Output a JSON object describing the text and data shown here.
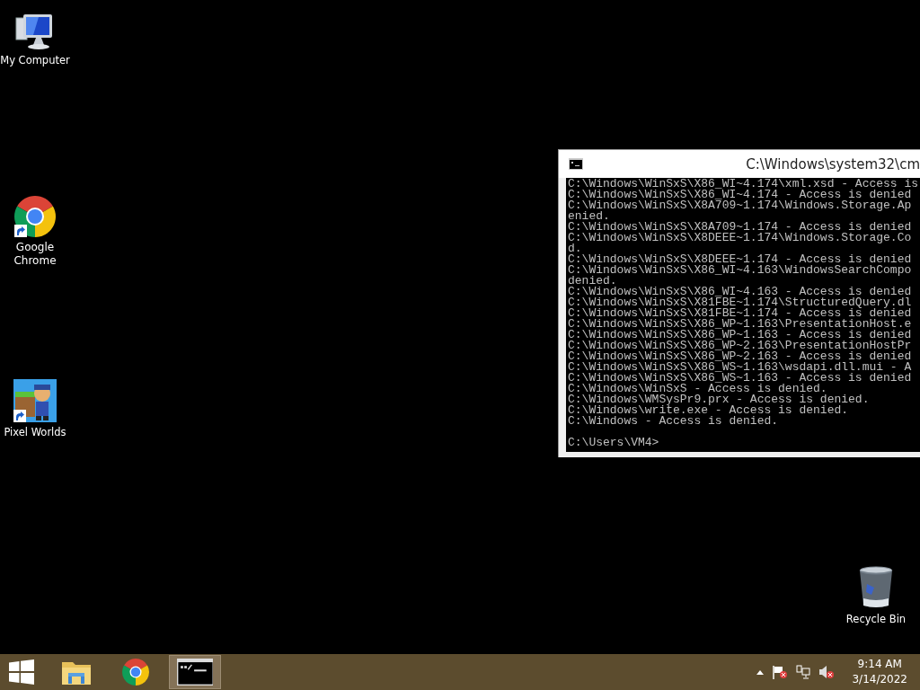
{
  "desktop_icons": [
    {
      "kind": "computer",
      "label": "My Computer",
      "shortcut": false
    },
    {
      "kind": "browser",
      "label": "Google Chrome",
      "shortcut": true
    },
    {
      "kind": "game",
      "label": "Pixel Worlds",
      "shortcut": true
    },
    {
      "kind": "trash",
      "label": "Recycle Bin",
      "shortcut": false
    }
  ],
  "console_window": {
    "title": "C:\\Windows\\system32\\cm",
    "lines": [
      "C:\\Windows\\WinSxS\\X86_WI~4.174\\xml.xsd - Access is",
      "C:\\Windows\\WinSxS\\X86_WI~4.174 - Access is denied",
      "C:\\Windows\\WinSxS\\X8A709~1.174\\Windows.Storage.Ap",
      "enied.",
      "C:\\Windows\\WinSxS\\X8A709~1.174 - Access is denied",
      "C:\\Windows\\WinSxS\\X8DEEE~1.174\\Windows.Storage.Co",
      "d.",
      "C:\\Windows\\WinSxS\\X8DEEE~1.174 - Access is denied",
      "C:\\Windows\\WinSxS\\X86_WI~4.163\\WindowsSearchCompo",
      "denied.",
      "C:\\Windows\\WinSxS\\X86_WI~4.163 - Access is denied",
      "C:\\Windows\\WinSxS\\X81FBE~1.174\\StructuredQuery.dl",
      "C:\\Windows\\WinSxS\\X81FBE~1.174 - Access is denied",
      "C:\\Windows\\WinSxS\\X86_WP~1.163\\PresentationHost.e",
      "C:\\Windows\\WinSxS\\X86_WP~1.163 - Access is denied",
      "C:\\Windows\\WinSxS\\X86_WP~2.163\\PresentationHostPr",
      "C:\\Windows\\WinSxS\\X86_WP~2.163 - Access is denied",
      "C:\\Windows\\WinSxS\\X86_WS~1.163\\wsdapi.dll.mui - A",
      "C:\\Windows\\WinSxS\\X86_WS~1.163 - Access is denied",
      "C:\\Windows\\WinSxS - Access is denied.",
      "C:\\Windows\\WMSysPr9.prx - Access is denied.",
      "C:\\Windows\\write.exe - Access is denied.",
      "C:\\Windows - Access is denied."
    ],
    "prompt": "C:\\Users\\VM4>"
  },
  "taskbar": {
    "apps": [
      {
        "kind": "folder",
        "selected": false
      },
      {
        "kind": "browser",
        "selected": false
      },
      {
        "kind": "console",
        "selected": true
      }
    ],
    "tray": {
      "time": "9:14 AM",
      "date": "3/14/2022"
    }
  }
}
